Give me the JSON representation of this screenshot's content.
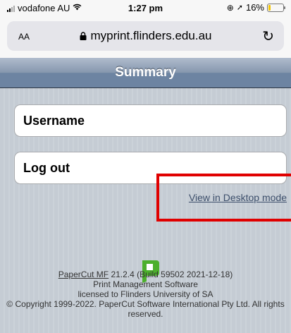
{
  "status_bar": {
    "carrier": "vodafone AU",
    "time": "1:27 pm",
    "battery_percent": "16%",
    "battery_level": 0.16
  },
  "address_bar": {
    "aa_label": "AA",
    "url": "myprint.flinders.edu.au"
  },
  "header": {
    "title": "Summary"
  },
  "menu": {
    "username_label": "Username",
    "logout_label": "Log out"
  },
  "desktop_link": "View in Desktop mode",
  "footer": {
    "product_link": "PaperCut MF",
    "version": "21.2.4 (Build 59502 2021-12-18)",
    "line2": "Print Management Software",
    "line3": "licensed to Flinders University of SA",
    "line4": "© Copyright 1999-2022. PaperCut Software International Pty Ltd. All rights reserved."
  },
  "colors": {
    "highlight": "#e00000",
    "logo": "#4caf2d"
  }
}
